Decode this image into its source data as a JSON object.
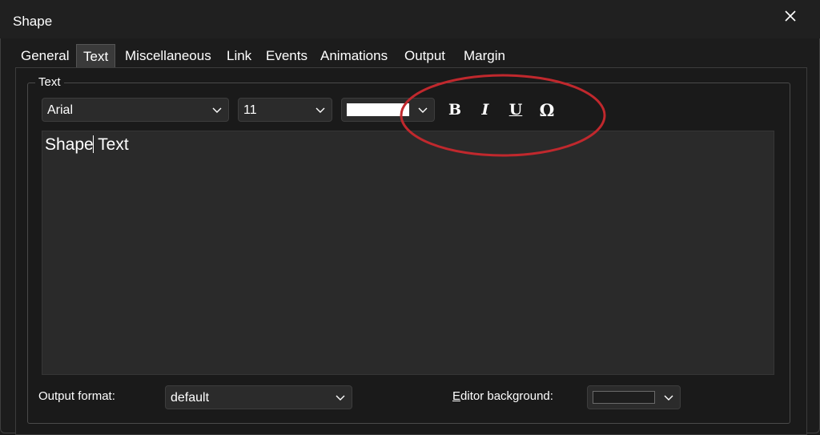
{
  "window": {
    "title": "Shape"
  },
  "tabs": [
    "General",
    "Text",
    "Miscellaneous",
    "Link",
    "Events",
    "Animations",
    "Output",
    "Margin"
  ],
  "active_tab": "Text",
  "group": {
    "legend": "Text"
  },
  "font_combo": {
    "value": "Arial"
  },
  "size_combo": {
    "value": "11"
  },
  "color_combo": {
    "color": "#ffffff"
  },
  "format_buttons": {
    "bold": "B",
    "italic": "I",
    "underline": "U",
    "symbol": "Ω"
  },
  "editor": {
    "content": "Shape Text"
  },
  "output_format": {
    "label": "Output format:",
    "value": "default"
  },
  "editor_background": {
    "label_accel": "E",
    "label_rest": "ditor background:",
    "color": "#1e1e1e"
  },
  "annotation": {
    "shape": "ellipse",
    "color": "#c0282d"
  },
  "colors": {
    "window_bg": "#1c1c1c",
    "titlebar_bg": "#202020",
    "editor_bg": "#2a2a2a",
    "active_tab_bg": "#3a3a3a"
  }
}
